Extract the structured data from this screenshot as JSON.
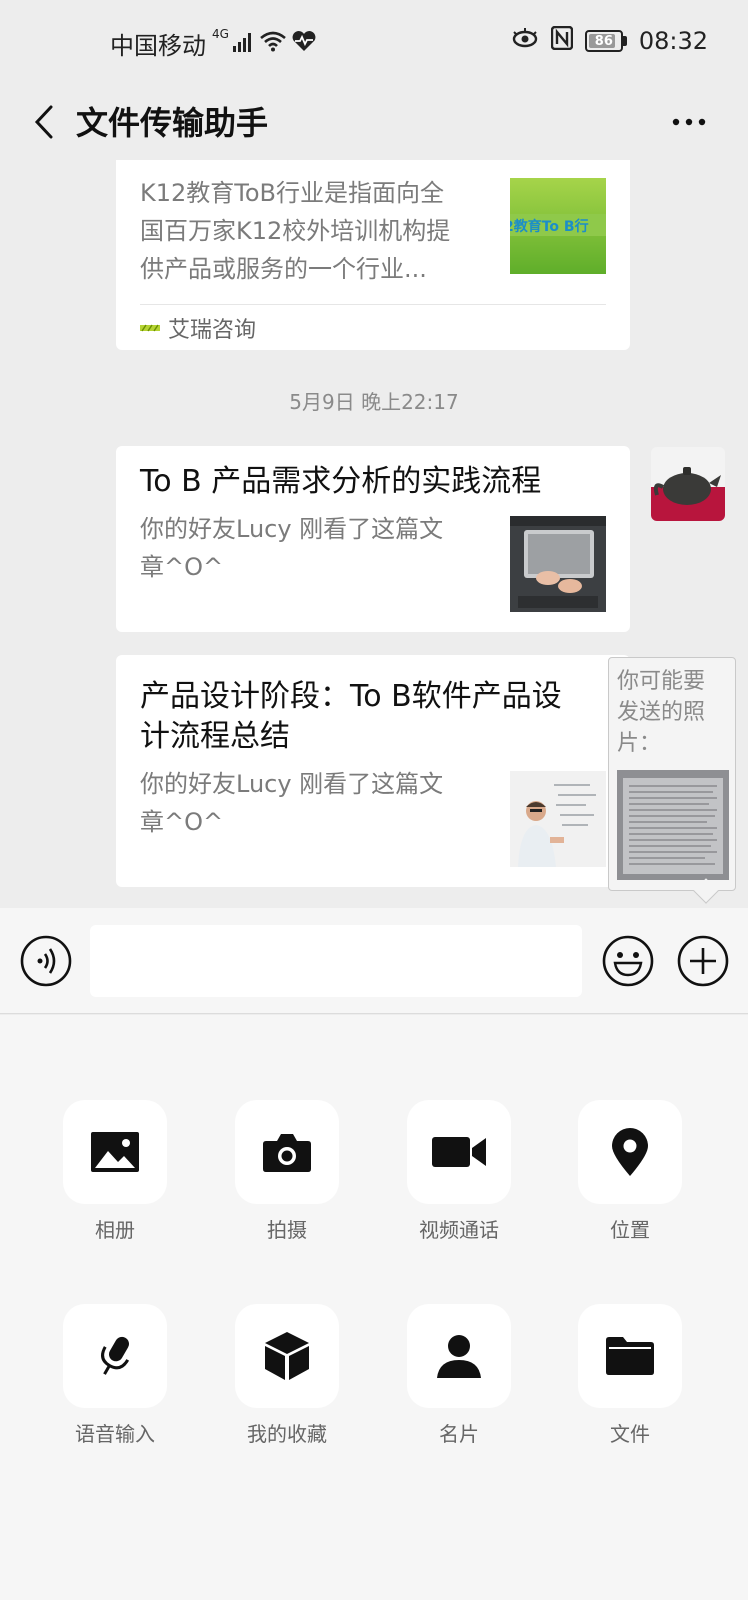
{
  "status_bar": {
    "carrier": "中国移动",
    "network": "4G",
    "battery": "86",
    "battery_level": 0.86,
    "time": "08:32"
  },
  "header": {
    "title": "文件传输助手",
    "back_icon": "chevron-left-icon",
    "more_icon": "more-icon"
  },
  "messages": [
    {
      "summary": "K12教育ToB行业是指面向全国百万家K12校外培训机构提供产品或服务的一个行业...",
      "summary_lines": [
        "K12教育ToB行业是指面向全",
        "国百万家K12校外培训机构提",
        "供产品或服务的一个行业..."
      ],
      "thumb_text": "2教育To B行",
      "source": "艾瑞咨询"
    },
    {
      "title": "To B 产品需求分析的实践流程",
      "summary_lines": [
        "你的好友Lucy 刚看了这篇文",
        "章^O^"
      ]
    },
    {
      "title_lines": [
        "产品设计阶段：To B软件产品设",
        "计流程总结"
      ],
      "summary_lines": [
        "你的好友Lucy 刚看了这篇文",
        "章^O^"
      ]
    }
  ],
  "timestamp": "5月9日 晚上22:17",
  "photo_tip": {
    "lines": [
      "你可能要",
      "发送的照",
      "片："
    ]
  },
  "input_bar": {
    "voice_icon": "voice-icon",
    "emoji_icon": "emoji-icon",
    "plus_icon": "plus-icon",
    "placeholder": ""
  },
  "panel": {
    "items": [
      {
        "label": "相册",
        "icon": "album-icon"
      },
      {
        "label": "拍摄",
        "icon": "camera-icon"
      },
      {
        "label": "视频通话",
        "icon": "video-call-icon"
      },
      {
        "label": "位置",
        "icon": "location-icon"
      },
      {
        "label": "语音输入",
        "icon": "microphone-icon"
      },
      {
        "label": "我的收藏",
        "icon": "favorites-icon"
      },
      {
        "label": "名片",
        "icon": "contact-card-icon"
      },
      {
        "label": "文件",
        "icon": "folder-icon"
      }
    ]
  }
}
